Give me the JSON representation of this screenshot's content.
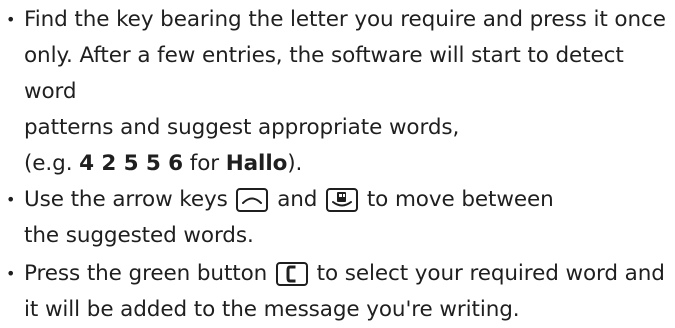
{
  "instructions": [
    {
      "line1": "Find the key bearing the letter you require and press it once",
      "line2": "only. After a few entries, the software will start to detect word",
      "line3": "patterns and suggest appropriate words,",
      "line4_prefix": "(e.g. ",
      "line4_digits": "4 2 5 5 6",
      "line4_mid": " for ",
      "line4_word": "Hallo",
      "line4_suffix": ")."
    },
    {
      "line1_prefix": "Use the arrow keys ",
      "line1_and": " and ",
      "line1_suffix": " to move between",
      "line2": "the suggested words.",
      "icons": [
        "up-arrow-key-icon",
        "down-navigation-key-icon"
      ]
    },
    {
      "line1_prefix": "Press the green button ",
      "line1_suffix": " to select your required word and",
      "line2": "it will be added to the message you're writing.",
      "icons": [
        "green-call-key-icon"
      ]
    }
  ],
  "bullet_char": "•"
}
